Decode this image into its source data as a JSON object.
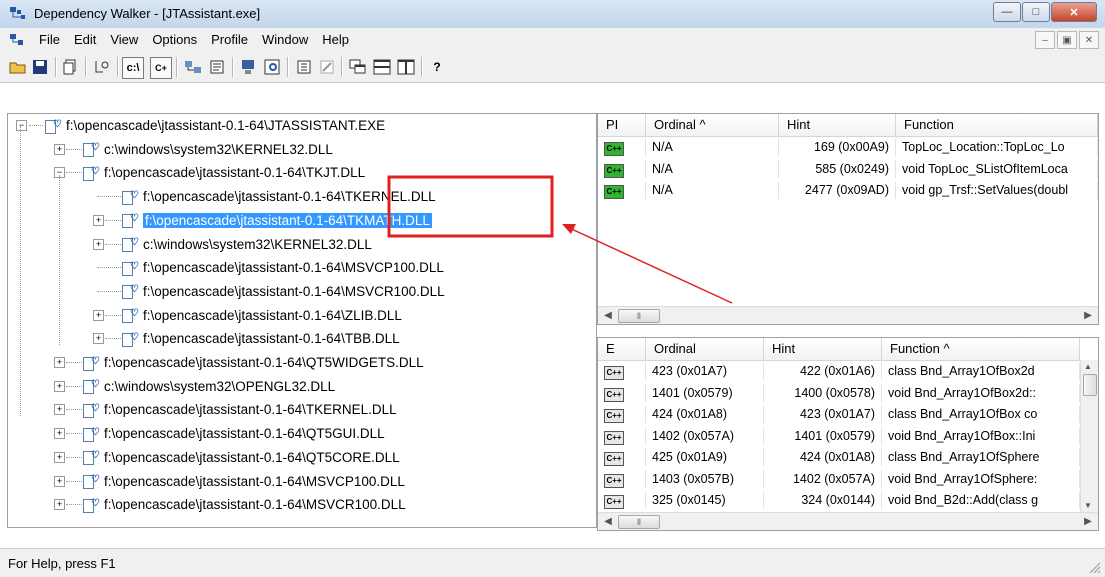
{
  "window": {
    "title": "Dependency Walker - [JTAssistant.exe]"
  },
  "menu": [
    "File",
    "Edit",
    "View",
    "Options",
    "Profile",
    "Window",
    "Help"
  ],
  "toolbar": {
    "path_label": "c:\\",
    "cpp_label": "C+",
    "help_label": "?"
  },
  "tree": [
    {
      "label": "f:\\opencascade\\jtassistant-0.1-64\\JTASSISTANT.EXE",
      "level": 0,
      "expander": "−"
    },
    {
      "label": "c:\\windows\\system32\\KERNEL32.DLL",
      "level": 1,
      "expander": "+"
    },
    {
      "label": "f:\\opencascade\\jtassistant-0.1-64\\TKJT.DLL",
      "level": 1,
      "expander": "−"
    },
    {
      "label": "f:\\opencascade\\jtassistant-0.1-64\\TKERNEL.DLL",
      "level": 2,
      "expander": ""
    },
    {
      "label": "f:\\opencascade\\jtassistant-0.1-64\\TKMATH.DLL",
      "level": 2,
      "expander": "+",
      "selected": true
    },
    {
      "label": "c:\\windows\\system32\\KERNEL32.DLL",
      "level": 2,
      "expander": "+"
    },
    {
      "label": "f:\\opencascade\\jtassistant-0.1-64\\MSVCP100.DLL",
      "level": 2,
      "expander": ""
    },
    {
      "label": "f:\\opencascade\\jtassistant-0.1-64\\MSVCR100.DLL",
      "level": 2,
      "expander": ""
    },
    {
      "label": "f:\\opencascade\\jtassistant-0.1-64\\ZLIB.DLL",
      "level": 2,
      "expander": "+"
    },
    {
      "label": "f:\\opencascade\\jtassistant-0.1-64\\TBB.DLL",
      "level": 2,
      "expander": "+"
    },
    {
      "label": "f:\\opencascade\\jtassistant-0.1-64\\QT5WIDGETS.DLL",
      "level": 1,
      "expander": "+"
    },
    {
      "label": "c:\\windows\\system32\\OPENGL32.DLL",
      "level": 1,
      "expander": "+"
    },
    {
      "label": "f:\\opencascade\\jtassistant-0.1-64\\TKERNEL.DLL",
      "level": 1,
      "expander": "+"
    },
    {
      "label": "f:\\opencascade\\jtassistant-0.1-64\\QT5GUI.DLL",
      "level": 1,
      "expander": "+"
    },
    {
      "label": "f:\\opencascade\\jtassistant-0.1-64\\QT5CORE.DLL",
      "level": 1,
      "expander": "+"
    },
    {
      "label": "f:\\opencascade\\jtassistant-0.1-64\\MSVCP100.DLL",
      "level": 1,
      "expander": "+"
    },
    {
      "label": "f:\\opencascade\\jtassistant-0.1-64\\MSVCR100.DLL",
      "level": 1,
      "expander": "+"
    }
  ],
  "imports": {
    "headers": [
      "PI",
      "Ordinal ^",
      "Hint",
      "Function"
    ],
    "rows": [
      {
        "badge": "C++",
        "ordinal": "N/A",
        "hint": "169 (0x00A9)",
        "function": "TopLoc_Location::TopLoc_Lo"
      },
      {
        "badge": "C++",
        "ordinal": "N/A",
        "hint": "585 (0x0249)",
        "function": "void TopLoc_SListOfItemLoca"
      },
      {
        "badge": "C++",
        "ordinal": "N/A",
        "hint": "2477 (0x09AD)",
        "function": "void gp_Trsf::SetValues(doubl"
      }
    ]
  },
  "exports": {
    "headers": [
      "E",
      "Ordinal",
      "Hint",
      "Function ^"
    ],
    "rows": [
      {
        "badge": "C++",
        "ordinal": "423 (0x01A7)",
        "hint": "422 (0x01A6)",
        "function": "class Bnd_Array1OfBox2d"
      },
      {
        "badge": "C++",
        "ordinal": "1401 (0x0579)",
        "hint": "1400 (0x0578)",
        "function": "void Bnd_Array1OfBox2d::"
      },
      {
        "badge": "C++",
        "ordinal": "424 (0x01A8)",
        "hint": "423 (0x01A7)",
        "function": "class Bnd_Array1OfBox co"
      },
      {
        "badge": "C++",
        "ordinal": "1402 (0x057A)",
        "hint": "1401 (0x0579)",
        "function": "void Bnd_Array1OfBox::Ini"
      },
      {
        "badge": "C++",
        "ordinal": "425 (0x01A9)",
        "hint": "424 (0x01A8)",
        "function": "class Bnd_Array1OfSphere"
      },
      {
        "badge": "C++",
        "ordinal": "1403 (0x057B)",
        "hint": "1402 (0x057A)",
        "function": "void Bnd_Array1OfSphere:"
      },
      {
        "badge": "C++",
        "ordinal": "325 (0x0145)",
        "hint": "324 (0x0144)",
        "function": "void Bnd_B2d::Add(class g"
      }
    ]
  },
  "status": {
    "text": "For Help, press F1"
  },
  "colors": {
    "selection": "#3399ff",
    "annotation": "#e02020",
    "cpp_badge_import": "#2fb52f"
  }
}
